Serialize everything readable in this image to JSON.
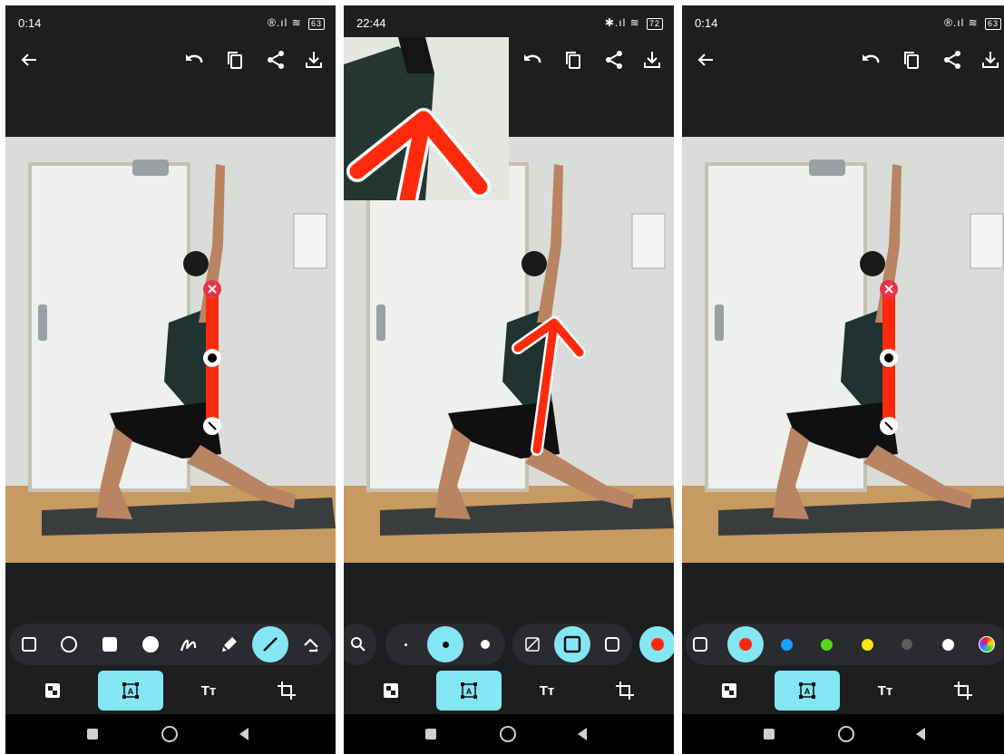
{
  "screens": [
    {
      "status": {
        "time": "0:14",
        "battery": "63"
      }
    },
    {
      "status": {
        "time": "22:44",
        "battery": "72"
      }
    },
    {
      "status": {
        "time": "0:14",
        "battery": "63"
      }
    }
  ],
  "tabs": {
    "text_label": "Tт"
  },
  "colors": {
    "accent": "#84e6f3",
    "annotation": "#ff2a0c",
    "palette": [
      "#ff2a0c",
      "#1aa0ff",
      "#58d51a",
      "#ffe01a",
      "#5c5c5c",
      "#ffffff"
    ]
  },
  "icons": [
    "back-arrow-icon",
    "undo-icon",
    "copy-icon",
    "share-icon",
    "download-icon",
    "rectangle-icon",
    "circle-icon",
    "filled-square-icon",
    "filled-circle-icon",
    "freehand-icon",
    "highlighter-icon",
    "line-icon",
    "arrow-icon",
    "zoom-icon",
    "mosaic-icon",
    "select-icon",
    "crop-icon"
  ]
}
